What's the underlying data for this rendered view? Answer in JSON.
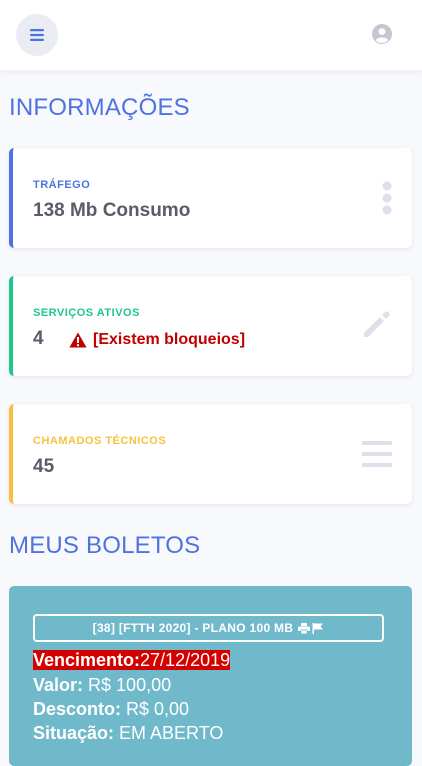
{
  "header": {
    "menu_icon": "menu-icon",
    "profile_icon": "user-circle-icon"
  },
  "sections": {
    "info_title": "INFORMAÇÕES",
    "boletos_title": "MEUS BOLETOS"
  },
  "cards": {
    "trafego": {
      "label": "TRÁFEGO",
      "value": "138 Mb Consumo",
      "accent": "#4e73df",
      "icon": "vertical-dots-icon"
    },
    "servicos": {
      "label": "SERVIÇOS ATIVOS",
      "value": "4",
      "warning": "[Existem bloqueios]",
      "accent": "#1cc88a",
      "icon": "pencil-icon"
    },
    "chamados": {
      "label": "CHAMADOS TÉCNICOS",
      "value": "45",
      "accent": "#f6c23e",
      "icon": "list-icon"
    }
  },
  "boleto": {
    "plan_button": "[38] [FTTH 2020] - PLANO 100 MB",
    "vencimento_label": "Vencimento:",
    "vencimento_value": "27/12/2019",
    "valor_label": "Valor:",
    "valor_value": " R$ 100,00",
    "desconto_label": "Desconto:",
    "desconto_value": " R$ 0,00",
    "situacao_label": "Situação:",
    "situacao_value": " EM ABERTO",
    "card_color": "#6fb9cb"
  }
}
